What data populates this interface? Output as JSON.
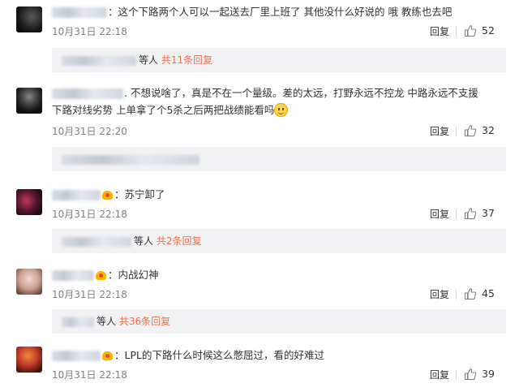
{
  "comments": [
    {
      "text": "：这个下路两个人可以一起送去厂里上班了 其他没什么好说的 哦 教练也去吧",
      "time": "10月31日 22:18",
      "reply_label": "回复",
      "likes": "52",
      "thread": {
        "others_label": "等人",
        "more_label": "共11条回复"
      }
    },
    {
      "text_line1": ". 不想说啥了，真是不在一个量级。差的太远，打野永远不控龙 中路永远不支援",
      "text_line2": "下路对线劣势 上单拿了个5杀之后两把战绩能看吗",
      "time": "10月31日 22:20",
      "reply_label": "回复",
      "likes": "32"
    },
    {
      "text": "：苏宁卸了",
      "time": "10月31日 22:18",
      "reply_label": "回复",
      "likes": "37",
      "thread": {
        "others_label": "等人",
        "more_label": "共2条回复"
      }
    },
    {
      "text": "：内战幻神",
      "time": "10月31日 22:18",
      "reply_label": "回复",
      "likes": "45",
      "thread": {
        "others_label": "等人",
        "more_label": "共36条回复"
      }
    },
    {
      "text": "：LPL的下路什么时候这么憋屈过，看的好难过",
      "time": "10月31日 22:18",
      "reply_label": "回复",
      "likes": "39"
    }
  ],
  "colors": {
    "link": "#eb7350",
    "subbox_bg": "#f2f2f5",
    "time": "#808080"
  },
  "icons": {
    "like": "thumbs-up-icon",
    "vip": "crown-badge-icon",
    "emoji": "smile-emoji-icon"
  }
}
